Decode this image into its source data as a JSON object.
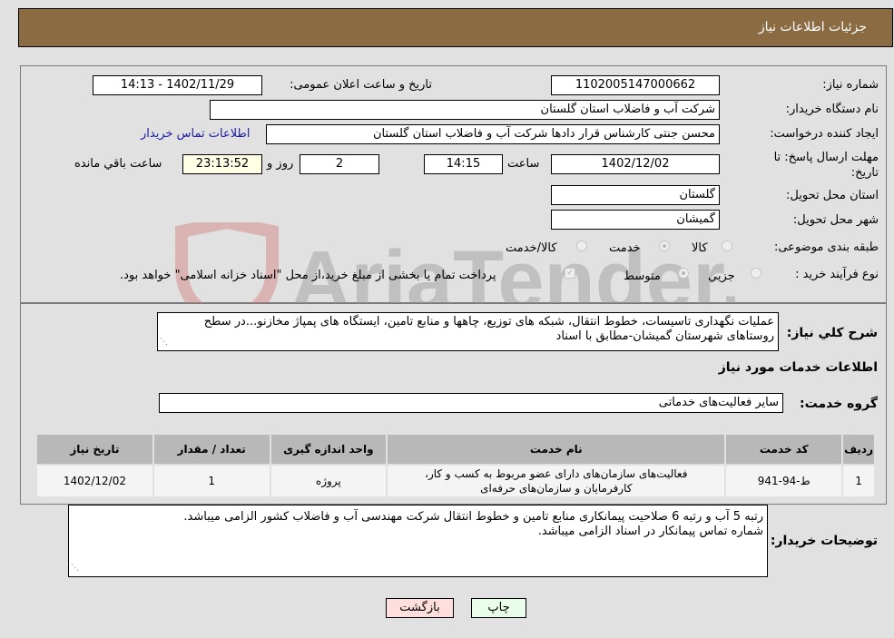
{
  "header": {
    "title": "جزئیات اطلاعات نیاز"
  },
  "form": {
    "need_number": {
      "label": "شماره نیاز:",
      "value": "1102005147000662"
    },
    "announce_datetime": {
      "label": "تاریخ و ساعت اعلان عمومی:",
      "value": "1402/11/29 - 14:13"
    },
    "buyer_org": {
      "label": "نام دستگاه خریدار:",
      "value": "شرکت آب و فاضلاب استان گلستان"
    },
    "requester": {
      "label": "ایجاد کننده درخواست:",
      "value": "محسن جنتی کارشناس قرار دادها شرکت آب و فاضلاب استان گلستان"
    },
    "buyer_contact_link": "اطلاعات تماس خریدار",
    "deadline": {
      "label_line1": "مهلت ارسال پاسخ: تا",
      "label_line2": "تاریخ:",
      "date": "1402/12/02",
      "time_label": "ساعت",
      "time": "14:15",
      "days": "2",
      "days_label": "روز و",
      "remaining": "23:13:52",
      "remaining_label": "ساعت باقي مانده"
    },
    "delivery_province": {
      "label": "استان محل تحویل:",
      "value": "گلستان"
    },
    "delivery_city": {
      "label": "شهر محل تحویل:",
      "value": "گمیشان"
    },
    "category": {
      "label": "طبقه بندی موضوعی:",
      "options": [
        "کالا",
        "خدمت",
        "کالا/خدمت"
      ],
      "selected": "خدمت"
    },
    "purchase_process": {
      "label": "نوع فرآیند خرید :",
      "options": [
        "جزیي",
        "متوسط"
      ],
      "selected": "متوسط",
      "payment_note": "پرداخت تمام یا بخشی از مبلغ خرید،از محل \"اسناد خزانه اسلامی\" خواهد بود.",
      "payment_checked": true
    }
  },
  "description": {
    "label": "شرح کلي نیاز:",
    "text": "عملیات نگهداری تاسیسات، خطوط انتقال، شبکه های توزیع، چاهها و منابع تامین، ایستگاه های پمپاژ مخازنو...در سطح روستاهای شهرستان گمیشان-مطابق با اسناد"
  },
  "services": {
    "section_title": "اطلاعات خدمات مورد نیاز",
    "group_label": "گروه خدمت:",
    "group_value": "سایر فعالیت‌های خدماتی",
    "table": {
      "headers": [
        "ردیف",
        "کد خدمت",
        "نام خدمت",
        "واحد اندازه گیری",
        "تعداد / مقدار",
        "تاریخ نیاز"
      ],
      "rows": [
        [
          "1",
          "ط-94-941",
          "فعالیت‌های سازمان‌های دارای عضو مربوط به کسب و کار، کارفرمایان و سازمان‌های حرفه‌ای",
          "پروژه",
          "1",
          "1402/12/02"
        ]
      ]
    }
  },
  "buyer_notes": {
    "label": "توضیحات خریدار:",
    "line1": "رتبه 5 آب و رتبه 6 صلاحیت پیمانکاری منابع تامین و خطوط انتقال شرکت مهندسی آب و فاضلاب کشور الزامی میباشد.",
    "line2": "شماره تماس پیمانکار در اسناد الزامی میباشد."
  },
  "buttons": {
    "print": "چاپ",
    "back": "بازگشت"
  },
  "watermark": {
    "text": "AriaTender.neT"
  },
  "colors": {
    "header_bg": "#8b6c42",
    "print_bg": "#e9ffe9",
    "back_bg": "#ffdede",
    "remaining_bg": "#ffffe5",
    "link": "#1a1aa8"
  }
}
